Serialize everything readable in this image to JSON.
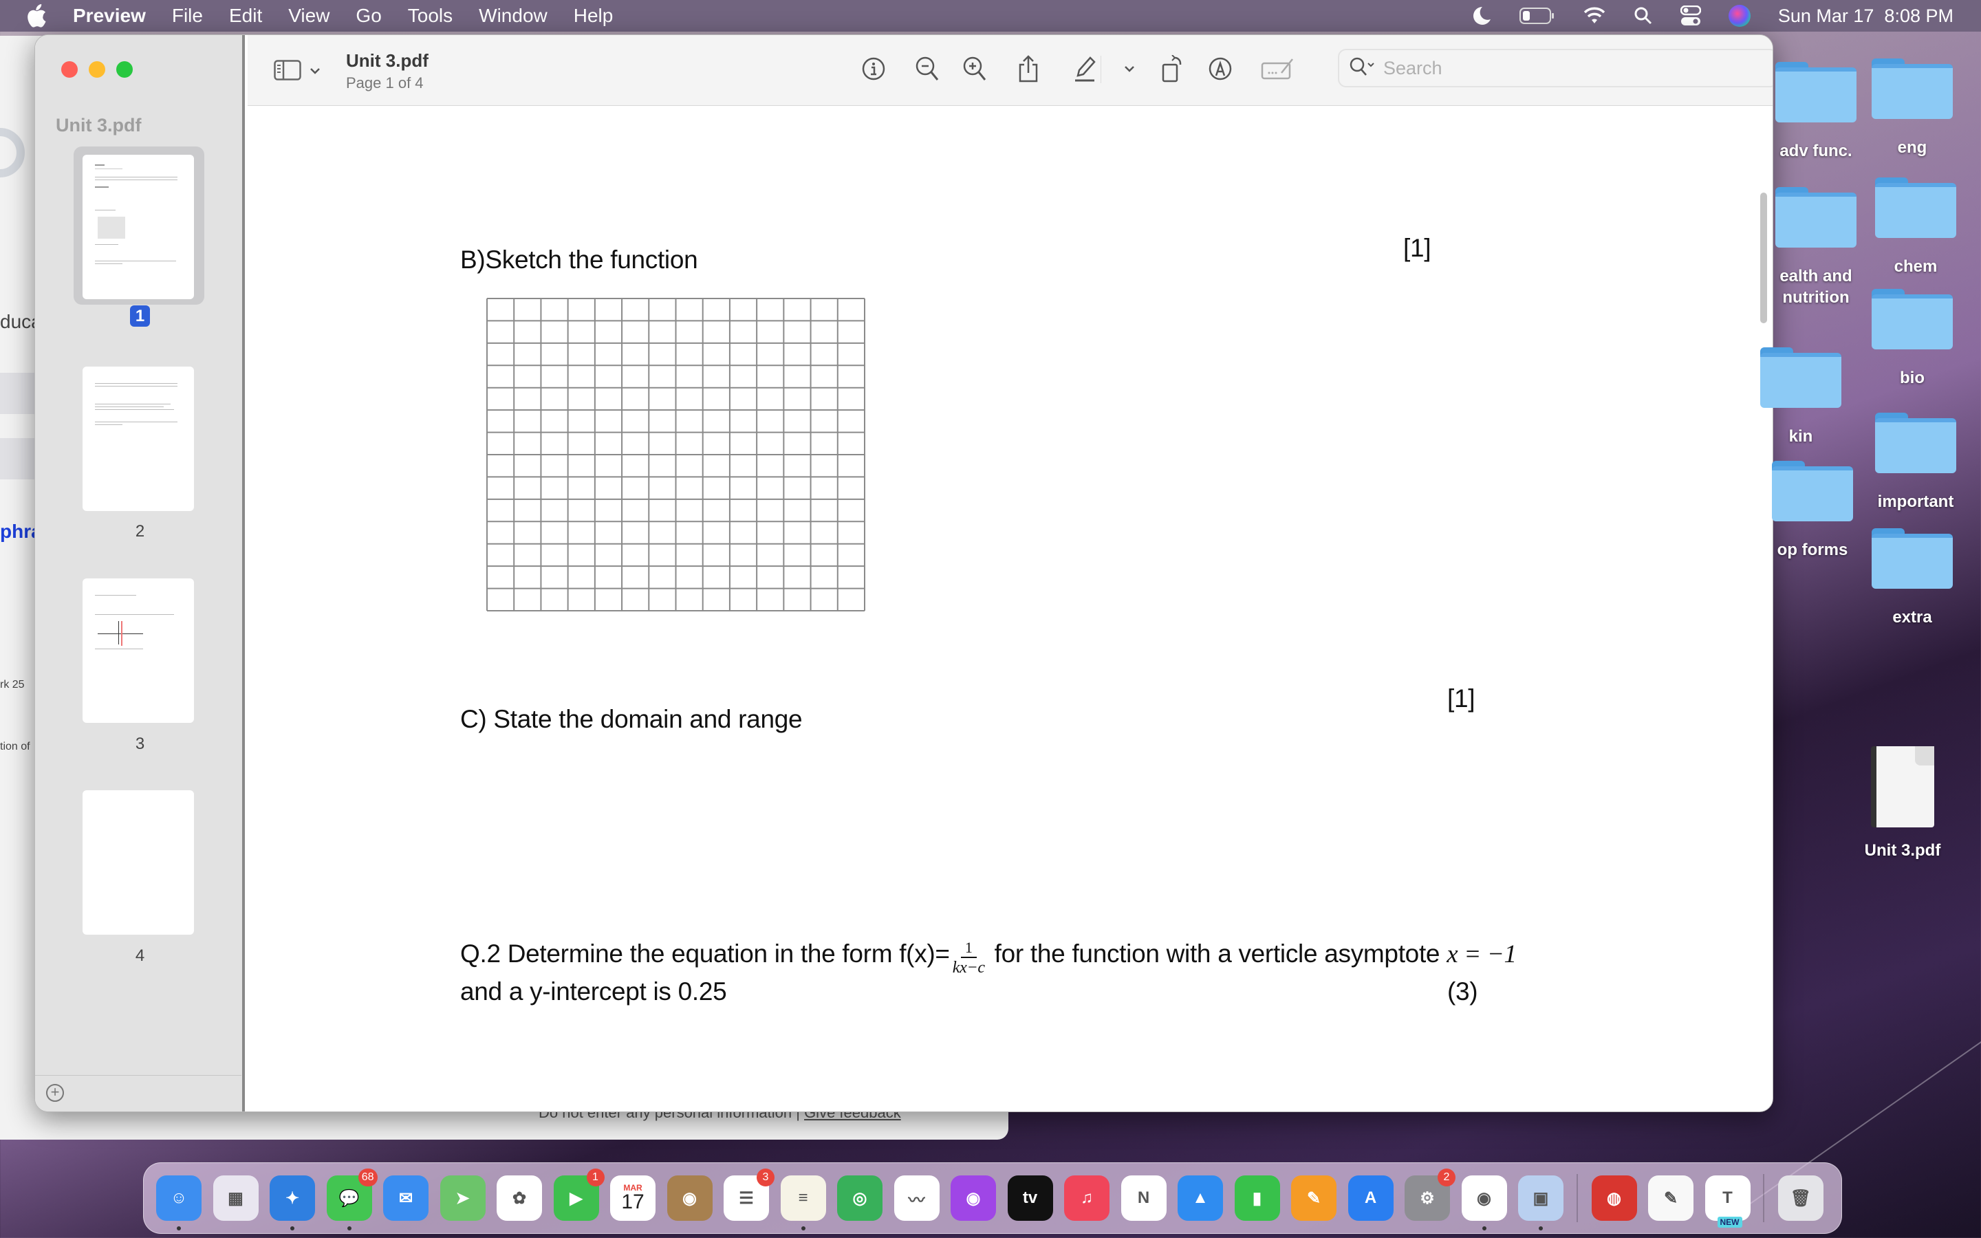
{
  "menubar": {
    "app_name": "Preview",
    "items": [
      "File",
      "Edit",
      "View",
      "Go",
      "Tools",
      "Window",
      "Help"
    ],
    "datetime": "Sun Mar 17  8:08 PM",
    "status_icons": [
      "focus-moon-icon",
      "battery-icon",
      "wifi-icon",
      "spotlight-search-icon",
      "control-center-icon",
      "siri-icon"
    ]
  },
  "background_window": {
    "fragments": [
      "duca",
      "phra",
      "rk 25",
      "tion of"
    ],
    "footer_text": "Do not enter any personal information |",
    "footer_link": "Give feedback"
  },
  "preview": {
    "sidebar": {
      "doc_title": "Unit 3.pdf",
      "pages": [
        {
          "number": "1",
          "selected": true
        },
        {
          "number": "2",
          "selected": false
        },
        {
          "number": "3",
          "selected": false
        },
        {
          "number": "4",
          "selected": false
        }
      ],
      "add_button": "+"
    },
    "toolbar": {
      "title": "Unit 3.pdf",
      "subtitle": "Page 1 of 4",
      "search_placeholder": "Search",
      "search_value": "",
      "icons": [
        "sidebar-toggle-icon",
        "info-icon",
        "zoom-out-icon",
        "zoom-in-icon",
        "share-icon",
        "markup-pen-icon",
        "chevron-down-icon",
        "rotate-icon",
        "annotate-icon",
        "form-fill-icon",
        "search-icon"
      ]
    },
    "document": {
      "part_b": "B)Sketch the function",
      "part_b_marks": "[1]",
      "grid": {
        "columns": 14,
        "rows": 14
      },
      "part_c": "C) State the domain and range",
      "part_c_marks": "[1]",
      "q2_prefix": "Q.2 Determine the equation in the form f(x)=",
      "q2_frac_num": "1",
      "q2_frac_den": "kx−c",
      "q2_suffix": " for the function with a verticle asymptote ",
      "q2_math": "x = −1",
      "q2_line2": "and a y-intercept is 0.25",
      "q2_marks": "(3)"
    }
  },
  "desktop": {
    "icons": [
      {
        "label": "adv func.",
        "type": "folder"
      },
      {
        "label": "eng",
        "type": "folder"
      },
      {
        "label": "ealth and\nnutrition",
        "type": "folder"
      },
      {
        "label": "chem",
        "type": "folder"
      },
      {
        "label": "bio",
        "type": "folder"
      },
      {
        "label": "kin",
        "type": "folder"
      },
      {
        "label": "important",
        "type": "folder"
      },
      {
        "label": "op forms",
        "type": "folder"
      },
      {
        "label": "extra",
        "type": "folder"
      },
      {
        "label": "Unit 3.pdf",
        "type": "pdf"
      }
    ]
  },
  "dock": {
    "apps": [
      {
        "name": "Finder",
        "color": "#3d8ef0",
        "glyph": "☺",
        "running": true
      },
      {
        "name": "Launchpad",
        "color": "#e9e6f0",
        "glyph": "▦",
        "running": false
      },
      {
        "name": "Safari",
        "color": "#2f7fe0",
        "glyph": "✦",
        "running": true
      },
      {
        "name": "Messages",
        "color": "#43c552",
        "glyph": "💬",
        "badge": "68",
        "running": true
      },
      {
        "name": "Mail",
        "color": "#3a8df0",
        "glyph": "✉",
        "running": false
      },
      {
        "name": "Maps",
        "color": "#6cc46a",
        "glyph": "➤",
        "running": false
      },
      {
        "name": "Photos",
        "color": "#ffffff",
        "glyph": "✿",
        "running": false
      },
      {
        "name": "FaceTime",
        "color": "#3ebf4f",
        "glyph": "▶",
        "badge": "1",
        "running": false
      },
      {
        "name": "Calendar",
        "color": "#ffffff",
        "glyph": "17",
        "month": "MAR",
        "running": false
      },
      {
        "name": "Contacts",
        "color": "#a7804f",
        "glyph": "◉",
        "running": false
      },
      {
        "name": "Reminders",
        "color": "#ffffff",
        "glyph": "☰",
        "badge": "3",
        "running": false
      },
      {
        "name": "Notes",
        "color": "#f6f3e6",
        "glyph": "≡",
        "running": true
      },
      {
        "name": "Find My",
        "color": "#38b05a",
        "glyph": "◎",
        "running": false
      },
      {
        "name": "Freeform",
        "color": "#ffffff",
        "glyph": "〰",
        "running": false
      },
      {
        "name": "Podcasts",
        "color": "#9f46e6",
        "glyph": "◉",
        "running": false
      },
      {
        "name": "TV",
        "color": "#111111",
        "glyph": "tv",
        "running": false
      },
      {
        "name": "Music",
        "color": "#f0455a",
        "glyph": "♫",
        "running": false
      },
      {
        "name": "News",
        "color": "#ffffff",
        "glyph": "N",
        "running": false
      },
      {
        "name": "Keynote",
        "color": "#2f8cf0",
        "glyph": "▲",
        "running": false
      },
      {
        "name": "Numbers",
        "color": "#38c14b",
        "glyph": "▮",
        "running": false
      },
      {
        "name": "Pages",
        "color": "#f59b25",
        "glyph": "✎",
        "running": false
      },
      {
        "name": "App Store",
        "color": "#2a7ef0",
        "glyph": "A",
        "running": false
      },
      {
        "name": "System Settings",
        "color": "#8e8e93",
        "glyph": "⚙",
        "badge": "2",
        "running": false
      },
      {
        "name": "Chrome",
        "color": "#ffffff",
        "glyph": "◉",
        "running": true
      },
      {
        "name": "Preview",
        "color": "#b9d0f0",
        "glyph": "▣",
        "running": true
      },
      {
        "name": "Photo Booth",
        "color": "#d8362f",
        "glyph": "◍",
        "running": false
      },
      {
        "name": "TextEdit",
        "color": "#f8f8f8",
        "glyph": "✎",
        "running": false
      },
      {
        "name": "Microsoft Teams",
        "color": "#ffffff",
        "glyph": "T",
        "tag": "NEW",
        "running": false
      },
      {
        "name": "Trash",
        "color": "#e4e4e8",
        "glyph": "🗑",
        "running": false
      }
    ]
  }
}
